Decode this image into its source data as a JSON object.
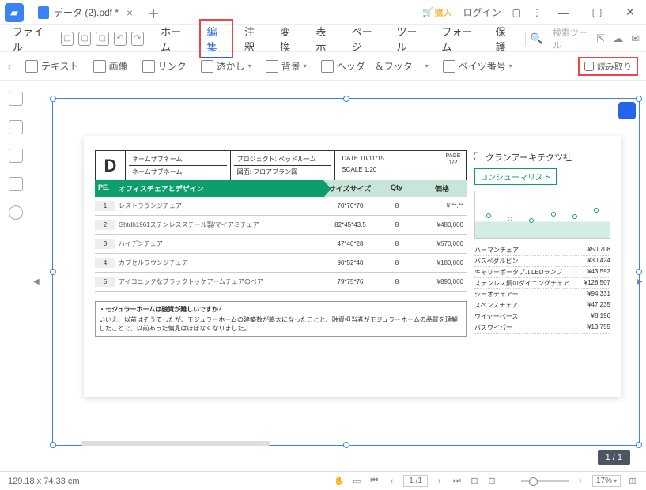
{
  "titlebar": {
    "tab_title": "データ (2).pdf *",
    "purchase": "購入",
    "login": "ログイン"
  },
  "menu": {
    "file": "ファイル",
    "home": "ホーム",
    "edit": "編集",
    "annotate": "注釈",
    "convert": "変換",
    "view": "表示",
    "page": "ページ",
    "tool": "ツール",
    "form": "フォーム",
    "protect": "保護",
    "search": "検索ツール"
  },
  "toolbar": {
    "text": "テキスト",
    "image": "画像",
    "link": "リンク",
    "watermark": "透かし",
    "background": "背景",
    "header_footer": "ヘッダー＆フッター",
    "bates": "ベイツ番号",
    "readonly": "読み取り"
  },
  "doc": {
    "logo": "D",
    "header": {
      "name_sub1": "ネームサブネーム",
      "name_sub2": "ネームサブネーム",
      "project": "プロジェクト: ベッドルーム",
      "drawing": "図面: フロアプラン図",
      "date": "DATE 10/11/15",
      "scale": "SCALE 1:20",
      "page_label": "PAGE",
      "page_val": "1/2"
    },
    "table_head": {
      "pe": "PE.",
      "name": "オフィスチェアとデザイン",
      "size": "サイズサイズ",
      "qty": "Qty",
      "price": "価格"
    },
    "rows": [
      {
        "pe": "1",
        "name": "レストラウンジチェア",
        "size": "70*70*70",
        "qty": "8",
        "price": "¥ **.**"
      },
      {
        "pe": "2",
        "name": "Ghtdh1961ステンレススチール製/マイアミチェア",
        "size": "82*45*43.5",
        "qty": "8",
        "price": "¥480,000"
      },
      {
        "pe": "3",
        "name": "ハイデンチェア",
        "size": "47*40*28",
        "qty": "8",
        "price": "¥570,000"
      },
      {
        "pe": "4",
        "name": "カプセルラウンジチェア",
        "size": "90*52*40",
        "qty": "8",
        "price": "¥180,000"
      },
      {
        "pe": "5",
        "name": "アイコニックなブラックトッケアームチェアのペア",
        "size": "79*75*76",
        "qty": "8",
        "price": "¥890,000"
      }
    ],
    "note_title": "・モジュラーホームは融資が難しいですか？",
    "note_body": "いいえ、以前はそうでしたが、モジュラーホームの建築数が膨大になったことと、融資担当者がモジュラーホームの品質を理解したことで、以前あった偏見はほぼなくなりました。",
    "brand": "クランアーキテクツ社",
    "consumer": "コンシューマリスト",
    "list": [
      {
        "n": "ハーマンチェア",
        "p": "¥50,708"
      },
      {
        "n": "バスペダルビン",
        "p": "¥30,424"
      },
      {
        "n": "キャリーポータブルLEDランプ",
        "p": "¥43,592"
      },
      {
        "n": "ステンレス鋼のダイニングチェア",
        "p": "¥128,507"
      },
      {
        "n": "シーオチェアー",
        "p": "¥94,331"
      },
      {
        "n": "スペンスチェア",
        "p": "¥47,235"
      },
      {
        "n": "ワイヤーベース",
        "p": "¥8,196"
      },
      {
        "n": "バスワイパー",
        "p": "¥13,755"
      }
    ]
  },
  "page_indicator": "1 / 1",
  "status": {
    "dims": "129.18 x 74.33 cm",
    "page": "1 /1",
    "zoom": "17%"
  },
  "chart_data": {
    "type": "line",
    "x": [
      1,
      2,
      3,
      4,
      5,
      6
    ],
    "values": [
      28,
      24,
      22,
      30,
      26,
      34
    ],
    "ylim": [
      0,
      40
    ]
  }
}
